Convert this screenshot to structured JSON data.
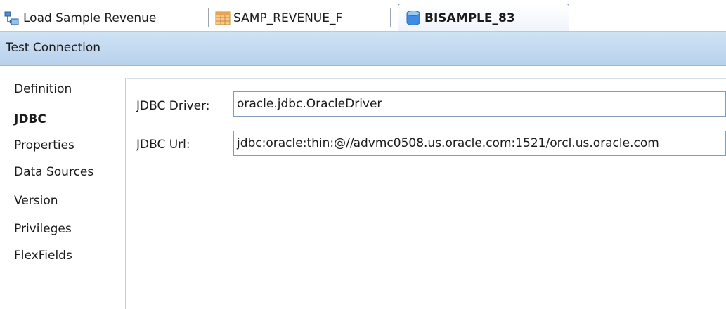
{
  "tabs": [
    {
      "label": "Load Sample Revenue",
      "icon": "mapping-icon",
      "active": false
    },
    {
      "label": "SAMP_REVENUE_F",
      "icon": "datastore-table-icon",
      "active": false
    },
    {
      "label": "BISAMPLE_83",
      "icon": "database-icon",
      "active": true
    }
  ],
  "toolbar": {
    "test_connection_label": "Test Connection"
  },
  "nav": {
    "items": [
      {
        "label": "Definition"
      },
      {
        "label": "JDBC"
      },
      {
        "label": "Properties"
      },
      {
        "label": "Data Sources"
      },
      {
        "label": "Version"
      },
      {
        "label": "Privileges"
      },
      {
        "label": "FlexFields"
      }
    ],
    "selected": "JDBC"
  },
  "form": {
    "jdbc_driver_label": "JDBC Driver:",
    "jdbc_driver_value": "oracle.jdbc.OracleDriver",
    "jdbc_url_label": "JDBC Url:",
    "jdbc_url_value_before_caret": "jdbc:oracle:thin:@//",
    "jdbc_url_value_after_caret": "advmc0508.us.oracle.com:1521/orcl.us.oracle.com"
  },
  "colors": {
    "toolbar_gradient_top": "#cfe2f5",
    "toolbar_gradient_bottom": "#b8d1ec",
    "input_border": "#7f9db9",
    "active_tab_border": "#8ea6c2"
  }
}
